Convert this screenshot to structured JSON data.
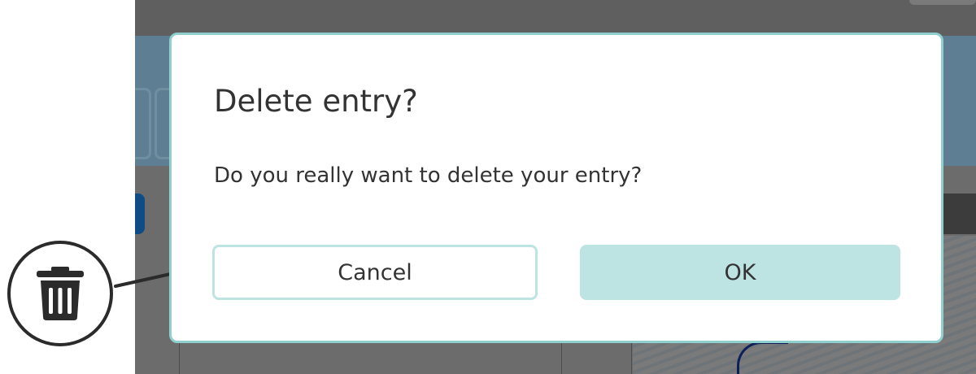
{
  "dialog": {
    "title": "Delete entry?",
    "message": "Do you really want to delete your entry?",
    "cancel_label": "Cancel",
    "ok_label": "OK"
  },
  "callout": {
    "icon": "trash-icon"
  },
  "colors": {
    "accent": "#bde3e2",
    "dialog_border": "#8fd0cf",
    "text": "#333333",
    "overlay": "#6c6c6c"
  }
}
